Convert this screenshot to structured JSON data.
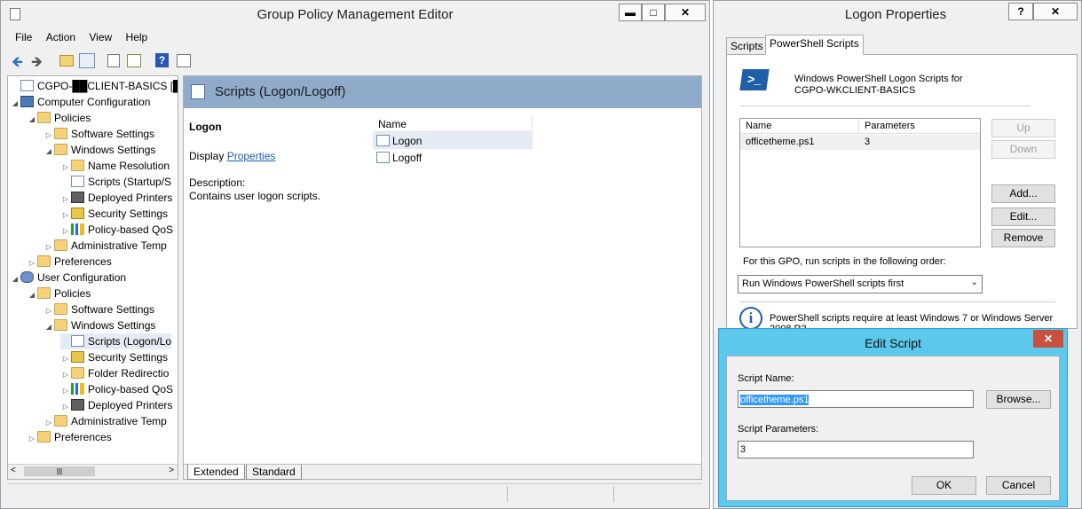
{
  "gpme": {
    "title": "Group Policy Management Editor",
    "menu": [
      "File",
      "Action",
      "View",
      "Help"
    ],
    "tree": [
      {
        "label": "CGPO-██CLIENT-BASICS [██",
        "level": 0,
        "exp": "",
        "icon": "scroll"
      },
      {
        "label": "Computer Configuration",
        "level": 0,
        "exp": "◢",
        "icon": "computer"
      },
      {
        "label": "Policies",
        "level": 1,
        "exp": "◢",
        "icon": "folder"
      },
      {
        "label": "Software Settings",
        "level": 2,
        "exp": "▷",
        "icon": "folder"
      },
      {
        "label": "Windows Settings",
        "level": 2,
        "exp": "◢",
        "icon": "folder"
      },
      {
        "label": "Name Resolution",
        "level": 3,
        "exp": "▷",
        "icon": "folder"
      },
      {
        "label": "Scripts (Startup/S",
        "level": 3,
        "exp": "",
        "icon": "scroll"
      },
      {
        "label": "Deployed Printers",
        "level": 3,
        "exp": "▷",
        "icon": "printer"
      },
      {
        "label": "Security Settings",
        "level": 3,
        "exp": "▷",
        "icon": "shield"
      },
      {
        "label": "Policy-based QoS",
        "level": 3,
        "exp": "▷",
        "icon": "bars"
      },
      {
        "label": "Administrative Temp",
        "level": 2,
        "exp": "▷",
        "icon": "folder"
      },
      {
        "label": "Preferences",
        "level": 1,
        "exp": "▷",
        "icon": "folder"
      },
      {
        "label": "User Configuration",
        "level": 0,
        "exp": "◢",
        "icon": "users"
      },
      {
        "label": "Policies",
        "level": 1,
        "exp": "◢",
        "icon": "folder"
      },
      {
        "label": "Software Settings",
        "level": 2,
        "exp": "▷",
        "icon": "folder"
      },
      {
        "label": "Windows Settings",
        "level": 2,
        "exp": "◢",
        "icon": "folder"
      },
      {
        "label": "Scripts (Logon/Lo",
        "level": 3,
        "exp": "",
        "icon": "scroll"
      },
      {
        "label": "Security Settings",
        "level": 3,
        "exp": "▷",
        "icon": "shield"
      },
      {
        "label": "Folder Redirectio",
        "level": 3,
        "exp": "▷",
        "icon": "folder"
      },
      {
        "label": "Policy-based QoS",
        "level": 3,
        "exp": "▷",
        "icon": "bars"
      },
      {
        "label": "Deployed Printers",
        "level": 3,
        "exp": "▷",
        "icon": "printer"
      },
      {
        "label": "Administrative Temp",
        "level": 2,
        "exp": "▷",
        "icon": "folder"
      },
      {
        "label": "Preferences",
        "level": 1,
        "exp": "▷",
        "icon": "folder"
      }
    ],
    "selected_index": 16,
    "pane_header": "Scripts (Logon/Logoff)",
    "detail_title": "Logon",
    "display_prefix": "Display",
    "display_link": "Properties",
    "description_label": "Description:",
    "description_text": "Contains user logon scripts.",
    "list_header": "Name",
    "list_items": [
      "Logon",
      "Logoff"
    ],
    "tabs": [
      "Extended",
      "Standard"
    ]
  },
  "logon_props": {
    "title": "Logon Properties",
    "help_btn": "?",
    "close_btn": "✕",
    "tabs": [
      "Scripts",
      "PowerShell Scripts"
    ],
    "heading_line1": "Windows PowerShell Logon Scripts for",
    "heading_line2": "CGPO-WKCLIENT-BASICS",
    "col_name": "Name",
    "col_params": "Parameters",
    "row_name": "officetheme.ps1",
    "row_params": "3",
    "btn_up": "Up",
    "btn_down": "Down",
    "btn_add": "Add...",
    "btn_edit": "Edit...",
    "btn_remove": "Remove",
    "order_label": "For this GPO, run scripts in the following order:",
    "order_value": "Run Windows PowerShell scripts first",
    "info_line1": "PowerShell scripts require at least Windows 7 or Windows Server",
    "info_line2": "2008 R2"
  },
  "edit_script": {
    "title": "Edit Script",
    "close_btn": "✕",
    "name_label": "Script Name:",
    "name_value": "officetheme.ps1",
    "browse": "Browse...",
    "params_label": "Script Parameters:",
    "params_value": "3",
    "ok": "OK",
    "cancel": "Cancel"
  }
}
